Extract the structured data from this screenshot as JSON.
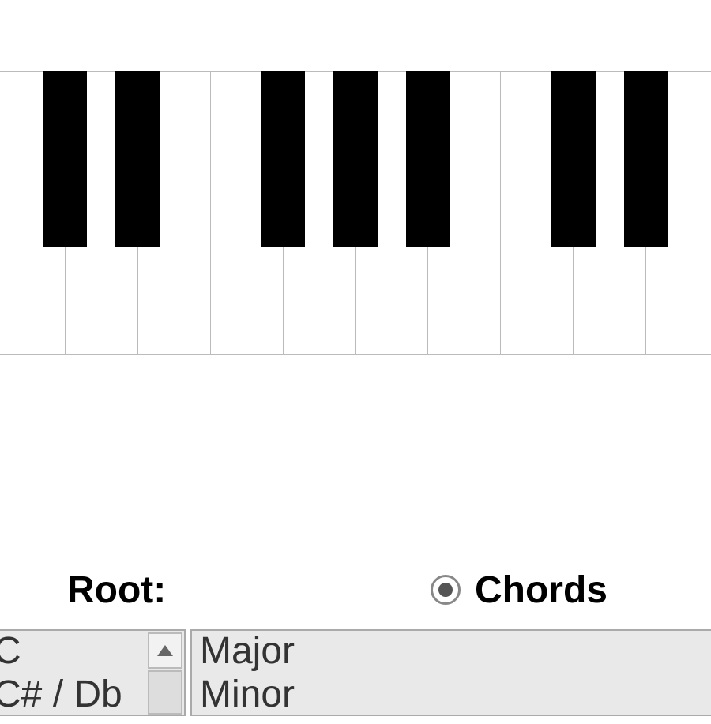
{
  "piano": {
    "white_key_count": 10,
    "black_key_positions": [
      0,
      1,
      3,
      4,
      5,
      7,
      8
    ]
  },
  "controls": {
    "root_label": "Root:",
    "mode_radio": {
      "label": "Chords",
      "selected": true
    },
    "root_options": [
      "C",
      "C# / Db"
    ],
    "chord_options": [
      "Major",
      "Minor"
    ]
  }
}
